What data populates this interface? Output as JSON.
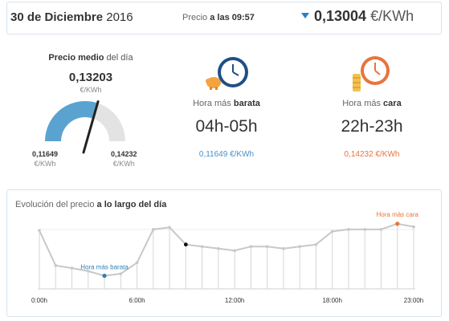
{
  "header": {
    "date_bold": "30 de Diciembre",
    "date_year": "2016",
    "time_prefix": "Precio",
    "time_bold": "a las 09:57",
    "current_price": "0,13004",
    "current_unit": "€/KWh",
    "arrow_color": "#2b7fc1"
  },
  "gauge": {
    "title_bold": "Precio medio",
    "title_rest": "del día",
    "value": "0,13203",
    "unit": "€/KWh",
    "min_value": "0,11649",
    "min_unit": "€/KWh",
    "max_value": "0,14232",
    "max_unit": "€/KWh",
    "fill_color": "#5aa3d0",
    "track_color": "#e3e3e3",
    "fraction": 0.6
  },
  "cheapest": {
    "label_prefix": "Hora más",
    "label_bold": "barata",
    "range": "04h-05h",
    "price": "0,11649 €/KWh",
    "icon": "clock-piggybank-icon"
  },
  "expensive": {
    "label_prefix": "Hora más",
    "label_bold": "cara",
    "range": "22h-23h",
    "price": "0,14232 €/KWh",
    "icon": "clock-coins-icon"
  },
  "chart_title_prefix": "Evolución del precio",
  "chart_title_bold": "a lo largo del día",
  "chart_data": {
    "type": "line",
    "x": [
      0,
      1,
      2,
      3,
      4,
      5,
      6,
      7,
      8,
      9,
      10,
      11,
      12,
      13,
      14,
      15,
      16,
      17,
      18,
      19,
      20,
      21,
      22,
      23
    ],
    "y": [
      0.139,
      0.1216,
      0.1203,
      0.1188,
      0.1165,
      0.1175,
      0.123,
      0.1395,
      0.1405,
      0.132,
      0.131,
      0.13,
      0.129,
      0.131,
      0.131,
      0.13,
      0.131,
      0.132,
      0.1385,
      0.1395,
      0.1395,
      0.1395,
      0.1423,
      0.1408
    ],
    "x_ticks": [
      {
        "x": 0,
        "label": "0:00h"
      },
      {
        "x": 6,
        "label": "6:00h"
      },
      {
        "x": 12,
        "label": "12:00h"
      },
      {
        "x": 18,
        "label": "18:00h"
      },
      {
        "x": 23,
        "label": "23:00h"
      }
    ],
    "ylim": [
      0.11,
      0.147
    ],
    "min_label": "Hora más barata",
    "max_label": "Hora más cara",
    "min_index": 4,
    "max_index": 22,
    "current_index": 9,
    "line_color": "#c8c8c8",
    "min_color": "#2f7fb8",
    "max_color": "#e8743b",
    "current_color": "#111111"
  }
}
